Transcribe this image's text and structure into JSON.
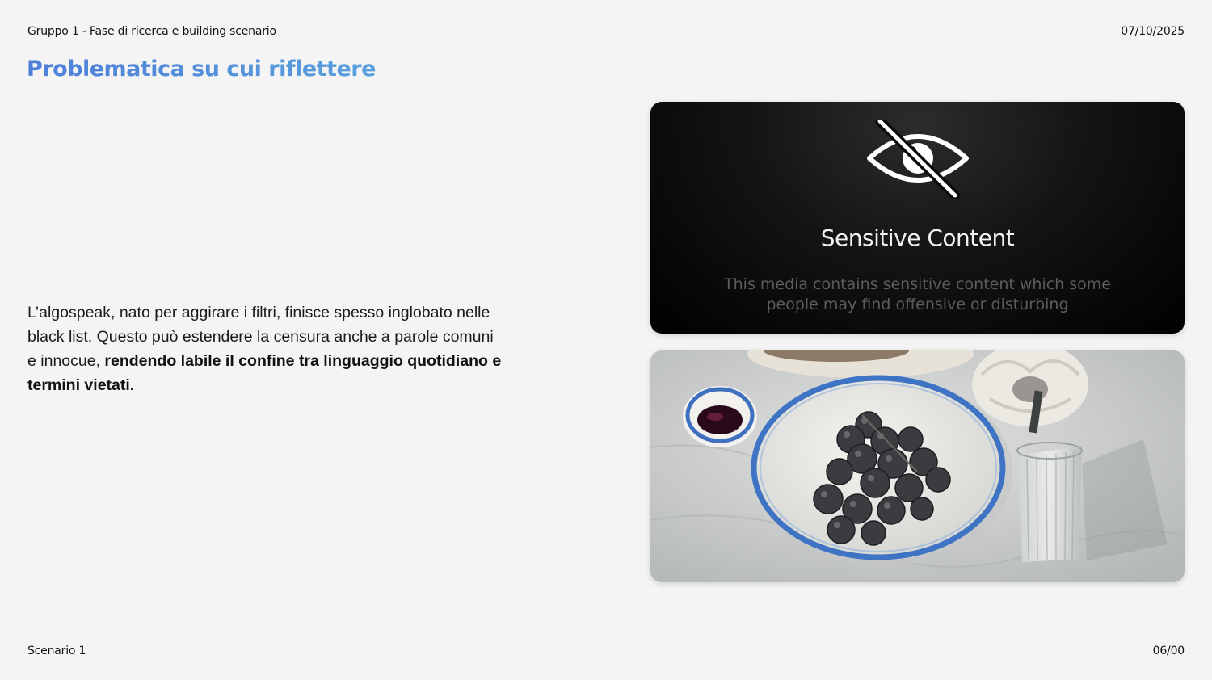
{
  "header": {
    "group_label": "Gruppo 1 - Fase di ricerca e building scenario",
    "date": "07/10/2025",
    "title": "Problematica su cui riflettere"
  },
  "body": {
    "text_regular": "L’algospeak, nato per aggirare i filtri, finisce spesso inglobato nelle black list. Questo può estendere la censura anche a parole comuni e innocue, ",
    "text_bold": "rendendo labile il confine tra linguaggio quotidiano e termini vietati."
  },
  "sensitive_card": {
    "icon": "eye-slash-icon",
    "title": "Sensitive Content",
    "description": "This media contains sensitive content which some people may find offensive or disturbing"
  },
  "photo_card": {
    "icon": "photo-grapes-wine-still-life"
  },
  "footer": {
    "scenario": "Scenario 1",
    "page": "06/00"
  },
  "colors": {
    "title_gradient_start": "#4e7fd9",
    "title_gradient_end": "#5aa0de",
    "background": "#f4f4f4",
    "card_dark": "#000000"
  }
}
